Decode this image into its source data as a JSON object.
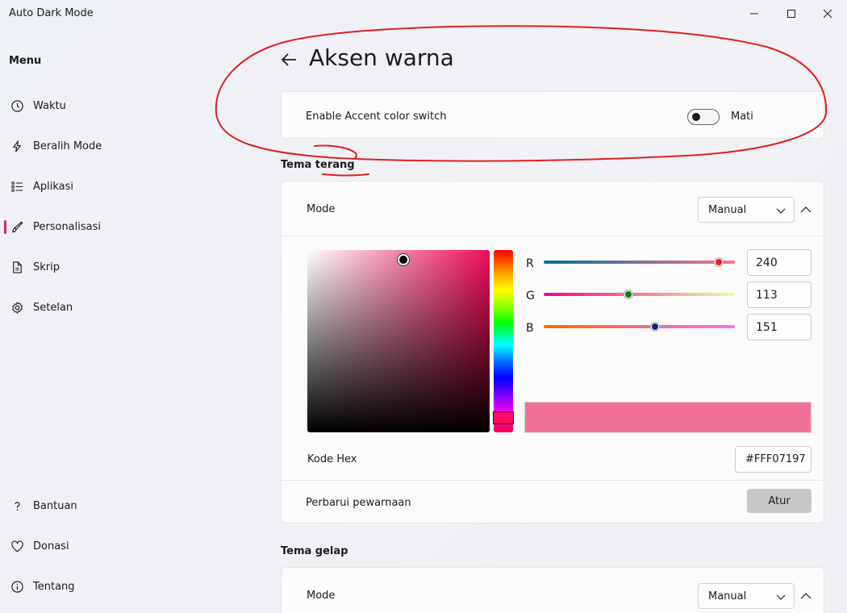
{
  "window": {
    "title": "Auto Dark Mode",
    "controls": [
      "minimize-icon",
      "maximize-icon",
      "close-icon"
    ]
  },
  "sidebar": {
    "menu_label": "Menu",
    "items": [
      {
        "label": "Waktu",
        "icon": "clock-icon"
      },
      {
        "label": "Beralih Mode",
        "icon": "lightning-icon"
      },
      {
        "label": "Aplikasi",
        "icon": "list-icon"
      },
      {
        "label": "Personalisasi",
        "icon": "brush-icon",
        "active": true
      },
      {
        "label": "Skrip",
        "icon": "document-icon"
      },
      {
        "label": "Setelan",
        "icon": "gear-icon"
      }
    ],
    "footer_items": [
      {
        "label": "Bantuan",
        "icon": "question-icon"
      },
      {
        "label": "Donasi",
        "icon": "heart-icon"
      },
      {
        "label": "Tentang",
        "icon": "info-icon"
      }
    ]
  },
  "page": {
    "title": "Aksen warna",
    "accent_switch": {
      "label": "Enable Accent color switch",
      "state": "Mati"
    }
  },
  "light_theme": {
    "title": "Tema terang",
    "mode_label": "Mode",
    "mode_value": "Manual",
    "rgb": {
      "r_label": "R",
      "r_value": "240",
      "g_label": "G",
      "g_value": "113",
      "b_label": "B",
      "b_value": "151"
    },
    "hex_label": "Kode Hex",
    "hex_value": "#FFF07197",
    "preview_color": "#f07197",
    "update_label": "Perbarui pewarnaan",
    "update_button": "Atur"
  },
  "dark_theme": {
    "title": "Tema gelap",
    "mode_label": "Mode",
    "mode_value": "Manual"
  },
  "colors": {
    "accent_bar": "#c4335a",
    "annotation": "#e0201e"
  }
}
